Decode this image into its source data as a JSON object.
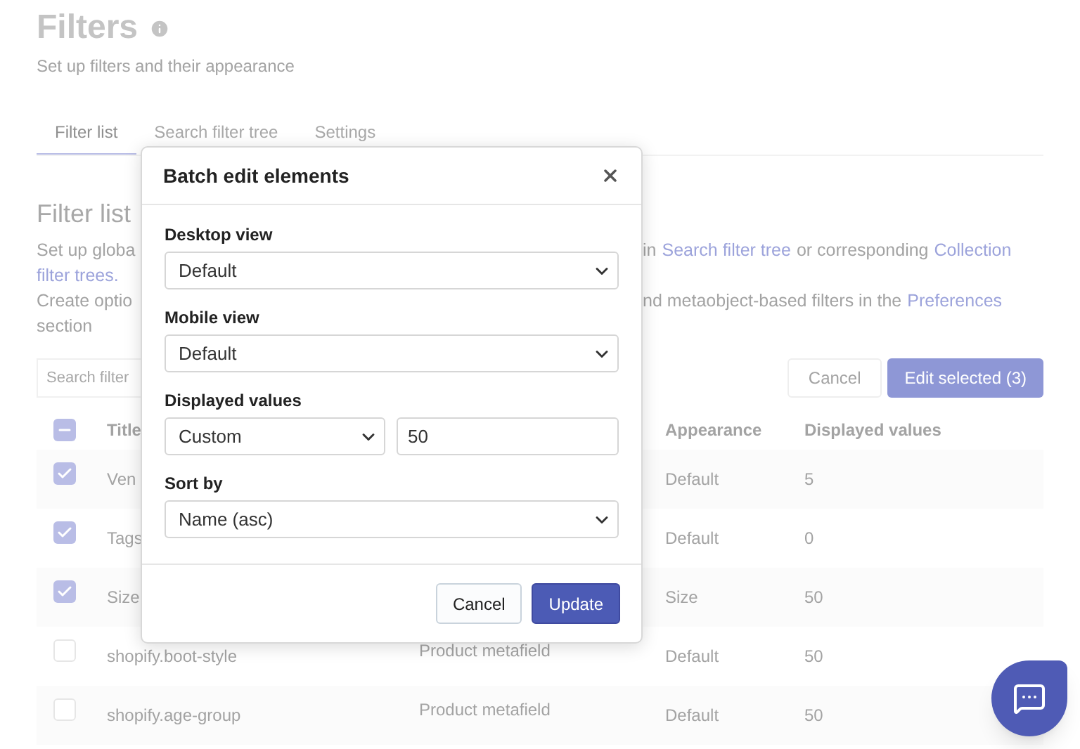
{
  "page": {
    "title": "Filters",
    "subtitle": "Set up filters and their appearance"
  },
  "tabs": [
    {
      "label": "Filter list",
      "selected": true
    },
    {
      "label": "Search filter tree",
      "selected": false
    },
    {
      "label": "Settings",
      "selected": false
    }
  ],
  "section": {
    "heading": "Filter list",
    "description": [
      {
        "left": "Set up globa",
        "right": [
          {
            "text": "in",
            "kind": "text"
          },
          {
            "text": "Search filter tree",
            "kind": "link"
          },
          {
            "text": "or corresponding",
            "kind": "text"
          },
          {
            "text": "Collection",
            "kind": "link"
          }
        ]
      },
      {
        "left_link": "filter trees."
      },
      {
        "left": "Create optio",
        "right": [
          {
            "text": "nd metaobject-based filters in the",
            "kind": "text"
          },
          {
            "text": "Preferences",
            "kind": "link"
          }
        ]
      },
      {
        "left": "section"
      }
    ]
  },
  "search": {
    "placeholder": "Search filter"
  },
  "actions": {
    "cancel": "Cancel",
    "edit": "Edit selected (3)"
  },
  "table": {
    "select_all": {
      "kind": "indeterminate"
    },
    "columns": [
      {
        "label": "Title"
      },
      {
        "label": "Appearance"
      },
      {
        "label": "Displayed values"
      }
    ],
    "rows": [
      {
        "selected": true,
        "title": "Ven",
        "appearance": "Default",
        "displayed_values": "5"
      },
      {
        "selected": true,
        "title": "Tags",
        "appearance": "Default",
        "displayed_values": "0"
      },
      {
        "selected": true,
        "title": "Size",
        "appearance": "Size",
        "displayed_values": "50"
      },
      {
        "selected": false,
        "title": "shopify.boot-style",
        "type": "Product metafield",
        "appearance": "Default",
        "displayed_values": "50"
      },
      {
        "selected": false,
        "title": "shopify.age-group",
        "type": "Product metafield",
        "appearance": "Default",
        "displayed_values": "50"
      }
    ]
  },
  "modal": {
    "title": "Batch edit elements",
    "fields": [
      {
        "label": "Desktop view",
        "controls": [
          {
            "kind": "select",
            "value": "Default"
          }
        ]
      },
      {
        "label": "Mobile view",
        "controls": [
          {
            "kind": "select",
            "value": "Default"
          }
        ]
      },
      {
        "label": "Displayed values",
        "controls": [
          {
            "kind": "select",
            "value": "Custom"
          },
          {
            "kind": "input",
            "value": "50"
          }
        ]
      },
      {
        "label": "Sort by",
        "controls": [
          {
            "kind": "select",
            "value": "Name (asc)"
          }
        ]
      }
    ],
    "cancel": "Cancel",
    "submit": "Update"
  }
}
